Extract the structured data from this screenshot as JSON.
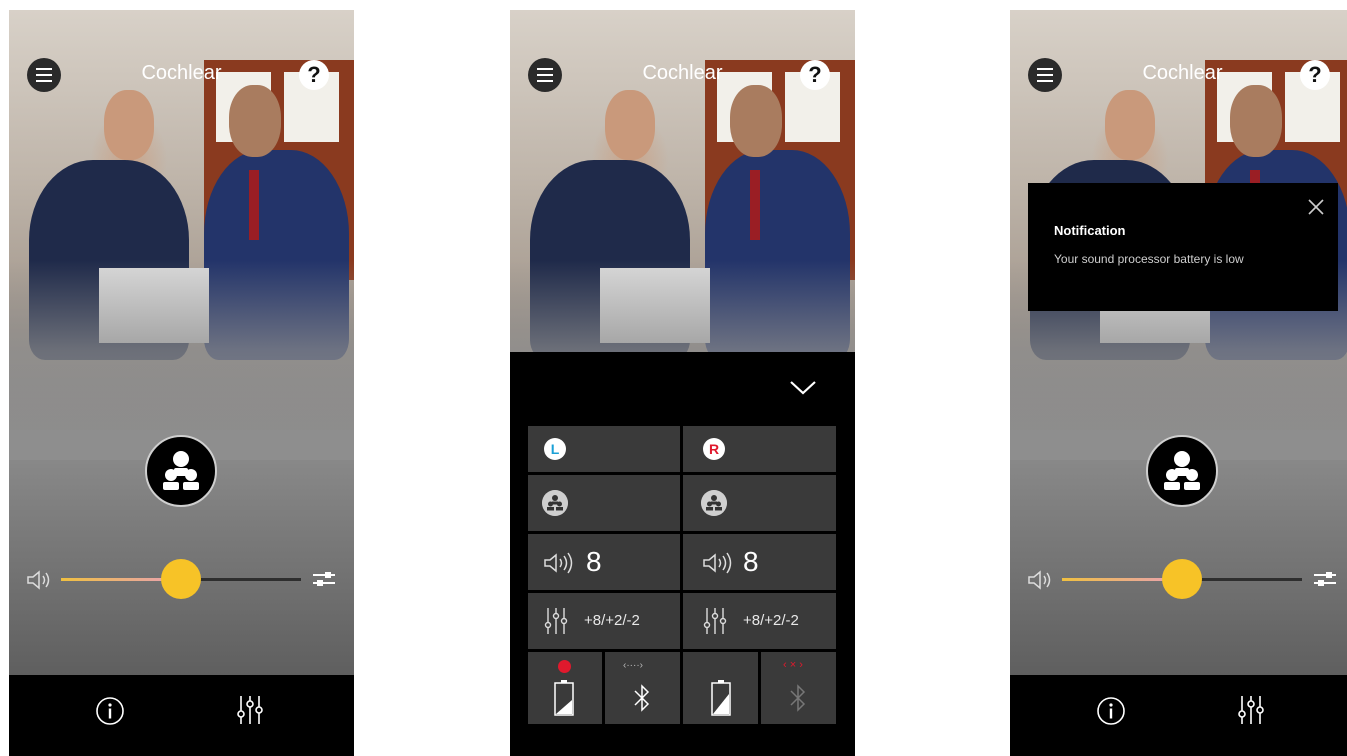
{
  "brand": "Cochlear",
  "help_label": "?",
  "volume_fraction": 0.5,
  "panel": {
    "left_badge": "L",
    "right_badge": "R",
    "left_volume": "8",
    "right_volume": "8",
    "left_eq": "+8/+2/-2",
    "right_eq": "+8/+2/-2",
    "left_link_label": "‹····›",
    "right_link_label": "‹ × ›"
  },
  "notification": {
    "title": "Notification",
    "message": "Your sound processor battery is low"
  },
  "colors": {
    "accent": "#f7c327",
    "left_badge": "#1aa0d6",
    "right_badge": "#e0192d",
    "status_red": "#e0192d"
  },
  "icons": {
    "menu": "hamburger-icon",
    "help": "help-icon",
    "program": "people-group-icon",
    "volume": "speaker-icon",
    "settings": "sliders-icon",
    "info": "info-icon",
    "mixer": "mixer-icon",
    "collapse": "chevron-down-icon",
    "battery": "battery-icon",
    "bluetooth": "bluetooth-icon",
    "close": "close-icon"
  }
}
